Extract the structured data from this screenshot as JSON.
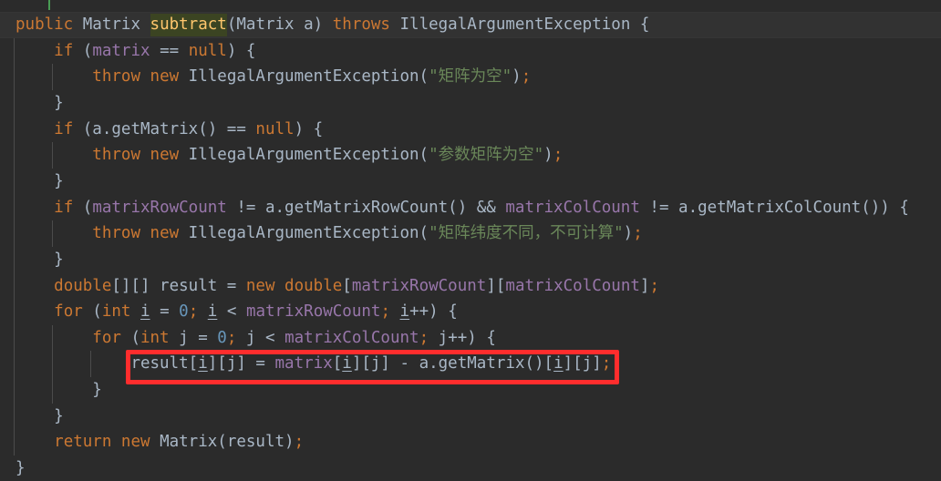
{
  "app": {
    "kind": "code-editor",
    "theme": "darcula",
    "language": "java"
  },
  "colors": {
    "background": "#2b2b2b",
    "current_line_background": "#323232",
    "default_text": "#a9b7c6",
    "keyword": "#cc7832",
    "field": "#9876aa",
    "string": "#6a8759",
    "number": "#6897bb",
    "method_declaration": "#ffc66d",
    "declaration_highlight_bg": "#3b4422",
    "indent_guide": "#4b4b4b",
    "annotation_box": "#ff2d2d",
    "top_marker": "#499c54"
  },
  "annotation": {
    "type": "rectangle-highlight",
    "color": "#ff2d2d",
    "target_line_index": 11,
    "target_text": "result[i][j] = matrix[i][j] - a.getMatrix()[i][j];"
  },
  "code": {
    "lines": [
      {
        "index": 0,
        "indent": 0,
        "current": true,
        "text": "public Matrix subtract(Matrix a) throws IllegalArgumentException {",
        "tokens": [
          {
            "t": "public",
            "c": "kw"
          },
          {
            "t": " ",
            "c": "txt"
          },
          {
            "t": "Matrix",
            "c": "typ"
          },
          {
            "t": " ",
            "c": "txt"
          },
          {
            "t": "subtract",
            "c": "mth hl-decl"
          },
          {
            "t": "(",
            "c": "txt"
          },
          {
            "t": "Matrix",
            "c": "typ"
          },
          {
            "t": " a) ",
            "c": "txt"
          },
          {
            "t": "throws",
            "c": "kw"
          },
          {
            "t": " IllegalArgumentException {",
            "c": "txt"
          }
        ]
      },
      {
        "index": 1,
        "indent": 1,
        "current": false,
        "text": "    if (matrix == null) {",
        "tokens": [
          {
            "t": "    ",
            "c": "ind"
          },
          {
            "t": "if",
            "c": "kw"
          },
          {
            "t": " (",
            "c": "txt"
          },
          {
            "t": "matrix",
            "c": "fld"
          },
          {
            "t": " == ",
            "c": "txt"
          },
          {
            "t": "null",
            "c": "kw"
          },
          {
            "t": ") {",
            "c": "txt"
          }
        ]
      },
      {
        "index": 2,
        "indent": 2,
        "current": false,
        "text": "        throw new IllegalArgumentException(\"矩阵为空\");",
        "tokens": [
          {
            "t": "        ",
            "c": "ind"
          },
          {
            "t": "throw",
            "c": "kw"
          },
          {
            "t": " ",
            "c": "txt"
          },
          {
            "t": "new",
            "c": "kw"
          },
          {
            "t": " IllegalArgumentException(",
            "c": "txt"
          },
          {
            "t": "\"矩阵为空\"",
            "c": "str"
          },
          {
            "t": ")",
            "c": "txt"
          },
          {
            "t": ";",
            "c": "kw"
          }
        ]
      },
      {
        "index": 3,
        "indent": 1,
        "current": false,
        "text": "    }",
        "tokens": [
          {
            "t": "    ",
            "c": "ind"
          },
          {
            "t": "}",
            "c": "txt"
          }
        ]
      },
      {
        "index": 4,
        "indent": 1,
        "current": false,
        "text": "    if (a.getMatrix() == null) {",
        "tokens": [
          {
            "t": "    ",
            "c": "ind"
          },
          {
            "t": "if",
            "c": "kw"
          },
          {
            "t": " (a.getMatrix() == ",
            "c": "txt"
          },
          {
            "t": "null",
            "c": "kw"
          },
          {
            "t": ") {",
            "c": "txt"
          }
        ]
      },
      {
        "index": 5,
        "indent": 2,
        "current": false,
        "text": "        throw new IllegalArgumentException(\"参数矩阵为空\");",
        "tokens": [
          {
            "t": "        ",
            "c": "ind"
          },
          {
            "t": "throw",
            "c": "kw"
          },
          {
            "t": " ",
            "c": "txt"
          },
          {
            "t": "new",
            "c": "kw"
          },
          {
            "t": " IllegalArgumentException(",
            "c": "txt"
          },
          {
            "t": "\"参数矩阵为空\"",
            "c": "str"
          },
          {
            "t": ")",
            "c": "txt"
          },
          {
            "t": ";",
            "c": "kw"
          }
        ]
      },
      {
        "index": 6,
        "indent": 1,
        "current": false,
        "text": "    }",
        "tokens": [
          {
            "t": "    ",
            "c": "ind"
          },
          {
            "t": "}",
            "c": "txt"
          }
        ]
      },
      {
        "index": 7,
        "indent": 1,
        "current": false,
        "text": "    if (matrixRowCount != a.getMatrixRowCount() && matrixColCount != a.getMatrixColCount())",
        "tokens": [
          {
            "t": "    ",
            "c": "ind"
          },
          {
            "t": "if",
            "c": "kw"
          },
          {
            "t": " (",
            "c": "txt"
          },
          {
            "t": "matrixRowCount",
            "c": "fld"
          },
          {
            "t": " != a.getMatrixRowCount() && ",
            "c": "txt"
          },
          {
            "t": "matrixColCount",
            "c": "fld"
          },
          {
            "t": " != a.getMatrixColCount()) {",
            "c": "txt"
          }
        ]
      },
      {
        "index": 8,
        "indent": 2,
        "current": false,
        "text": "        throw new IllegalArgumentException(\"矩阵纬度不同，不可计算\");",
        "tokens": [
          {
            "t": "        ",
            "c": "ind"
          },
          {
            "t": "throw",
            "c": "kw"
          },
          {
            "t": " ",
            "c": "txt"
          },
          {
            "t": "new",
            "c": "kw"
          },
          {
            "t": " IllegalArgumentException(",
            "c": "txt"
          },
          {
            "t": "\"矩阵纬度不同，不可计算\"",
            "c": "str"
          },
          {
            "t": ")",
            "c": "txt"
          },
          {
            "t": ";",
            "c": "kw"
          }
        ]
      },
      {
        "index": 9,
        "indent": 1,
        "current": false,
        "text": "    }",
        "tokens": [
          {
            "t": "    ",
            "c": "ind"
          },
          {
            "t": "}",
            "c": "txt"
          }
        ]
      },
      {
        "index": 10,
        "indent": 1,
        "current": false,
        "text": "    double[][] result = new double[matrixRowCount][matrixColCount];",
        "tokens": [
          {
            "t": "    ",
            "c": "ind"
          },
          {
            "t": "double",
            "c": "kw"
          },
          {
            "t": "[][] result = ",
            "c": "txt"
          },
          {
            "t": "new",
            "c": "kw"
          },
          {
            "t": " ",
            "c": "txt"
          },
          {
            "t": "double",
            "c": "kw"
          },
          {
            "t": "[",
            "c": "txt"
          },
          {
            "t": "matrixRowCount",
            "c": "fld"
          },
          {
            "t": "][",
            "c": "txt"
          },
          {
            "t": "matrixColCount",
            "c": "fld"
          },
          {
            "t": "]",
            "c": "txt"
          },
          {
            "t": ";",
            "c": "kw"
          }
        ]
      },
      {
        "index": 11,
        "indent": 1,
        "current": false,
        "text": "    for (int i = 0; i < matrixRowCount; i++) {",
        "tokens": [
          {
            "t": "    ",
            "c": "ind"
          },
          {
            "t": "for",
            "c": "kw"
          },
          {
            "t": " (",
            "c": "txt"
          },
          {
            "t": "int",
            "c": "kw"
          },
          {
            "t": " ",
            "c": "txt"
          },
          {
            "t": "i",
            "c": "lvar"
          },
          {
            "t": " = ",
            "c": "txt"
          },
          {
            "t": "0",
            "c": "num"
          },
          {
            "t": "; ",
            "c": "kw"
          },
          {
            "t": "i",
            "c": "lvar"
          },
          {
            "t": " < ",
            "c": "txt"
          },
          {
            "t": "matrixRowCount",
            "c": "fld"
          },
          {
            "t": ";",
            "c": "kw"
          },
          {
            "t": " ",
            "c": "txt"
          },
          {
            "t": "i",
            "c": "lvar"
          },
          {
            "t": "++) {",
            "c": "txt"
          }
        ]
      },
      {
        "index": 12,
        "indent": 2,
        "current": false,
        "text": "        for (int j = 0; j < matrixColCount; j++) {",
        "tokens": [
          {
            "t": "        ",
            "c": "ind"
          },
          {
            "t": "for",
            "c": "kw"
          },
          {
            "t": " (",
            "c": "txt"
          },
          {
            "t": "int",
            "c": "kw"
          },
          {
            "t": " j = ",
            "c": "txt"
          },
          {
            "t": "0",
            "c": "num"
          },
          {
            "t": "; ",
            "c": "kw"
          },
          {
            "t": "j < ",
            "c": "txt"
          },
          {
            "t": "matrixColCount",
            "c": "fld"
          },
          {
            "t": ";",
            "c": "kw"
          },
          {
            "t": " j++) {",
            "c": "txt"
          }
        ]
      },
      {
        "index": 13,
        "indent": 3,
        "current": false,
        "text": "            result[i][j] = matrix[i][j] - a.getMatrix()[i][j];",
        "boxed": true,
        "tokens": [
          {
            "t": "            ",
            "c": "ind"
          },
          {
            "t": "result[",
            "c": "txt"
          },
          {
            "t": "i",
            "c": "lvar"
          },
          {
            "t": "][j] = ",
            "c": "txt"
          },
          {
            "t": "matrix",
            "c": "fld"
          },
          {
            "t": "[",
            "c": "txt"
          },
          {
            "t": "i",
            "c": "lvar"
          },
          {
            "t": "][j] - a.getMatrix()[",
            "c": "txt"
          },
          {
            "t": "i",
            "c": "lvar"
          },
          {
            "t": "][j]",
            "c": "txt"
          },
          {
            "t": ";",
            "c": "kw"
          }
        ]
      },
      {
        "index": 14,
        "indent": 2,
        "current": false,
        "text": "        }",
        "tokens": [
          {
            "t": "        ",
            "c": "ind"
          },
          {
            "t": "}",
            "c": "txt"
          }
        ]
      },
      {
        "index": 15,
        "indent": 1,
        "current": false,
        "text": "    }",
        "tokens": [
          {
            "t": "    ",
            "c": "ind"
          },
          {
            "t": "}",
            "c": "txt"
          }
        ]
      },
      {
        "index": 16,
        "indent": 1,
        "current": false,
        "text": "    return new Matrix(result);",
        "tokens": [
          {
            "t": "    ",
            "c": "ind"
          },
          {
            "t": "return",
            "c": "kw"
          },
          {
            "t": " ",
            "c": "txt"
          },
          {
            "t": "new",
            "c": "kw"
          },
          {
            "t": " Matrix(result)",
            "c": "txt"
          },
          {
            "t": ";",
            "c": "kw"
          }
        ]
      },
      {
        "index": 17,
        "indent": 0,
        "current": false,
        "text": "}",
        "tokens": [
          {
            "t": "}",
            "c": "txt"
          }
        ]
      }
    ]
  }
}
